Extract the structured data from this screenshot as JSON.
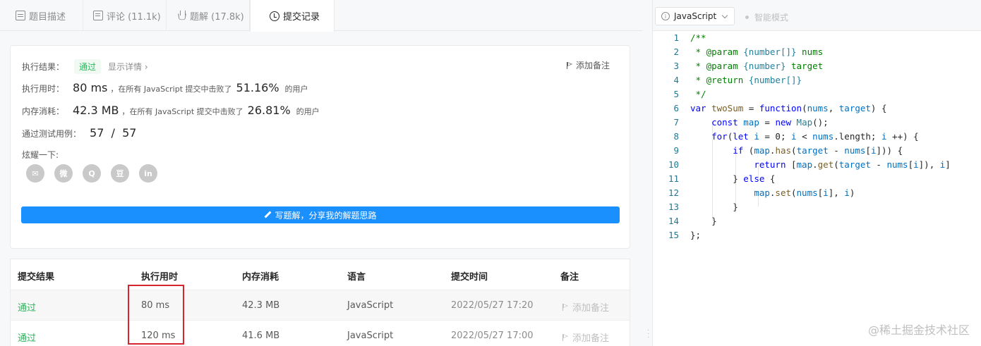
{
  "tabs": [
    {
      "label": "题目描述",
      "icon": "document-icon"
    },
    {
      "label": "评论 (11.1k)",
      "icon": "comment-icon"
    },
    {
      "label": "题解 (17.8k)",
      "icon": "flask-icon"
    },
    {
      "label": "提交记录",
      "icon": "clock-icon"
    }
  ],
  "result": {
    "result_label": "执行结果：",
    "status": "通过",
    "detail_link": "显示详情 ›",
    "add_note": "添加备注",
    "runtime_label": "执行用时：",
    "runtime_value": "80 ms",
    "runtime_mid": "，在所有 JavaScript 提交中击败了",
    "runtime_pct": "51.16%",
    "runtime_suffix": "的用户",
    "memory_label": "内存消耗：",
    "memory_value": "42.3 MB",
    "memory_mid": "，在所有 JavaScript 提交中击败了",
    "memory_pct": "26.81%",
    "memory_suffix": "的用户",
    "tests_label": "通过测试用例：",
    "tests_value": "57  /  57",
    "share_label": "炫耀一下:",
    "share_icons": [
      "wechat-icon",
      "weibo-icon",
      "qq-icon",
      "douban-icon",
      "linkedin-icon"
    ],
    "share_glyphs": [
      "✉",
      "微",
      "Q",
      "豆",
      "in"
    ],
    "write_button": "写题解，分享我的解题思路"
  },
  "table": {
    "headers": [
      "提交结果",
      "执行用时",
      "内存消耗",
      "语言",
      "提交时间",
      "备注"
    ],
    "rows": [
      {
        "status": "通过",
        "runtime": "80 ms",
        "memory": "42.3 MB",
        "language": "JavaScript",
        "time": "2022/05/27 17:20",
        "note": "添加备注"
      },
      {
        "status": "通过",
        "runtime": "120 ms",
        "memory": "41.6 MB",
        "language": "JavaScript",
        "time": "2022/05/27 17:00",
        "note": "添加备注"
      }
    ]
  },
  "editor": {
    "language": "JavaScript",
    "mode": "智能模式",
    "line_numbers": [
      "1",
      "2",
      "3",
      "4",
      "5",
      "6",
      "7",
      "8",
      "9",
      "10",
      "11",
      "12",
      "13",
      "14",
      "15"
    ],
    "code_lines": [
      "/**",
      " * @param {number[]} nums",
      " * @param {number} target",
      " * @return {number[]}",
      " */",
      "var twoSum = function(nums, target) {",
      "    const map = new Map();",
      "    for(let i = 0; i < nums.length; i ++) {",
      "        if (map.has(target - nums[i])) {",
      "            return [map.get(target - nums[i]), i]",
      "        } else {",
      "            map.set(nums[i], i)",
      "        }",
      "    }",
      "};"
    ]
  },
  "watermark": "@稀土掘金技术社区",
  "colors": {
    "accent": "#1a90ff",
    "pass": "#2db55d",
    "highlight_box": "#d72530"
  }
}
